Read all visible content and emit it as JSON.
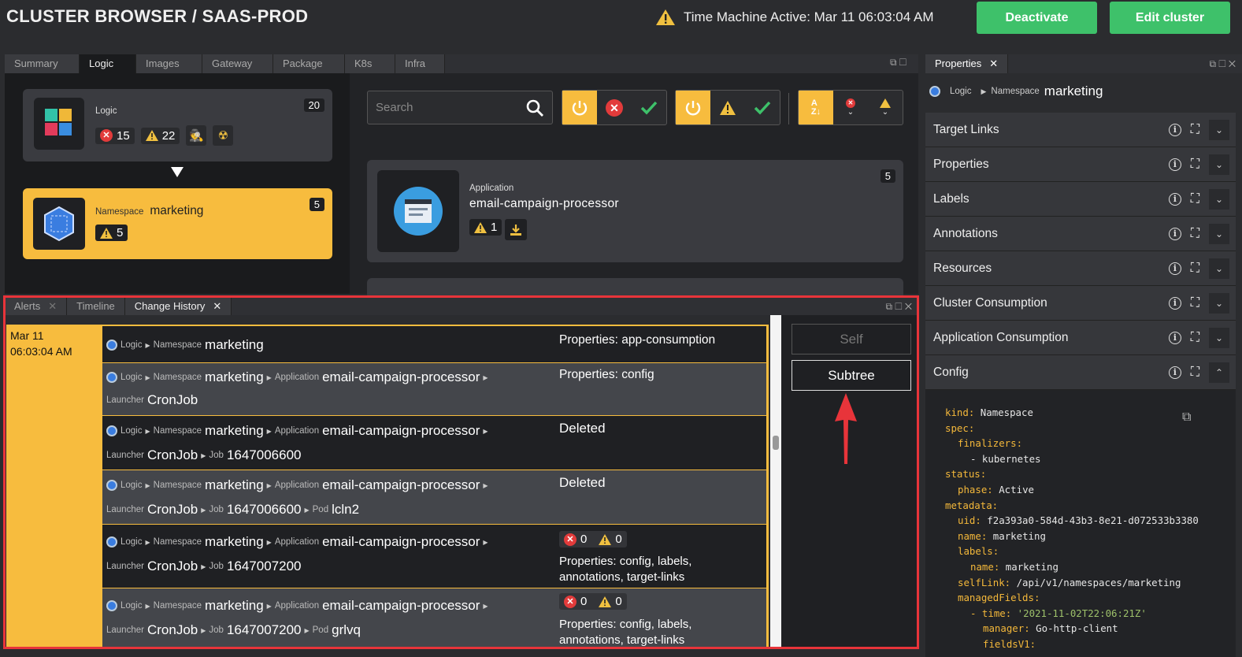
{
  "header": {
    "title": "CLUSTER BROWSER / SAAS-PROD",
    "time_machine": "Time Machine Active: Mar 11 06:03:04 AM",
    "deactivate_label": "Deactivate",
    "edit_label": "Edit cluster"
  },
  "main_tabs": [
    "Summary",
    "Logic",
    "Images",
    "Gateway",
    "Package",
    "K8s",
    "Infra"
  ],
  "logic_card": {
    "kind": "Logic",
    "count": "20",
    "errors": "15",
    "warnings": "22"
  },
  "namespace_card": {
    "kind": "Namespace",
    "name": "marketing",
    "count": "5",
    "warnings": "5"
  },
  "search": {
    "placeholder": "Search"
  },
  "app_card": {
    "kind": "Application",
    "name": "email-campaign-processor",
    "count": "5",
    "warnings": "1",
    "count2": "5"
  },
  "bottom_tabs": [
    "Alerts",
    "Timeline",
    "Change History"
  ],
  "history": {
    "date": "Mar 11",
    "time": "06:03:04 AM",
    "rows": [
      {
        "line1": [
          "Logic",
          "Namespace",
          "marketing"
        ],
        "line2": [],
        "change": "Properties: app-consumption"
      },
      {
        "line1": [
          "Logic",
          "Namespace",
          "marketing",
          "Application",
          "email-campaign-processor"
        ],
        "line2": [
          "Launcher",
          "CronJob"
        ],
        "change": "Properties: config"
      },
      {
        "line1": [
          "Logic",
          "Namespace",
          "marketing",
          "Application",
          "email-campaign-processor"
        ],
        "line2": [
          "Launcher",
          "CronJob",
          "Job",
          "1647006600"
        ],
        "change": "Deleted"
      },
      {
        "line1": [
          "Logic",
          "Namespace",
          "marketing",
          "Application",
          "email-campaign-processor"
        ],
        "line2": [
          "Launcher",
          "CronJob",
          "Job",
          "1647006600",
          "Pod",
          "lcln2"
        ],
        "change": "Deleted"
      },
      {
        "line1": [
          "Logic",
          "Namespace",
          "marketing",
          "Application",
          "email-campaign-processor"
        ],
        "line2": [
          "Launcher",
          "CronJob",
          "Job",
          "1647007200"
        ],
        "errors": "0",
        "warnings": "0",
        "change": "Properties: config, labels,",
        "change2": "annotations, target-links"
      },
      {
        "line1": [
          "Logic",
          "Namespace",
          "marketing",
          "Application",
          "email-campaign-processor"
        ],
        "line2": [
          "Launcher",
          "CronJob",
          "Job",
          "1647007200",
          "Pod",
          "grlvq"
        ],
        "errors": "0",
        "warnings": "0",
        "change": "Properties: config, labels,",
        "change2": "annotations, target-links"
      }
    ]
  },
  "scope_buttons": {
    "self": "Self",
    "subtree": "Subtree"
  },
  "properties_panel": {
    "tab": "Properties",
    "breadcrumb": {
      "logic": "Logic",
      "kind": "Namespace",
      "name": "marketing"
    },
    "sections": [
      "Target Links",
      "Properties",
      "Labels",
      "Annotations",
      "Resources",
      "Cluster Consumption",
      "Application Consumption",
      "Config"
    ]
  },
  "yaml": [
    {
      "i": 0,
      "k": "kind",
      "v": "Namespace"
    },
    {
      "i": 0,
      "k": "spec",
      "v": ""
    },
    {
      "i": 1,
      "k": "finalizers",
      "v": ""
    },
    {
      "i": 2,
      "k": "",
      "v": "- kubernetes"
    },
    {
      "i": 0,
      "k": "status",
      "v": ""
    },
    {
      "i": 1,
      "k": "phase",
      "v": "Active"
    },
    {
      "i": 0,
      "k": "metadata",
      "v": ""
    },
    {
      "i": 1,
      "k": "uid",
      "v": "f2a393a0-584d-43b3-8e21-d072533b3380"
    },
    {
      "i": 1,
      "k": "name",
      "v": "marketing"
    },
    {
      "i": 1,
      "k": "labels",
      "v": ""
    },
    {
      "i": 2,
      "k": "name",
      "v": "marketing"
    },
    {
      "i": 1,
      "k": "selfLink",
      "v": "/api/v1/namespaces/marketing"
    },
    {
      "i": 1,
      "k": "managedFields",
      "v": ""
    },
    {
      "i": 2,
      "k": "- time",
      "v": "'2021-11-02T22:06:21Z'",
      "str": true
    },
    {
      "i": 3,
      "k": "manager",
      "v": "Go-http-client"
    },
    {
      "i": 3,
      "k": "fieldsV1",
      "v": ""
    }
  ],
  "colors": {
    "accent": "#f7bc3e",
    "green": "#3ec16a",
    "error": "#e23b3b",
    "highlight": "#e8343a"
  }
}
